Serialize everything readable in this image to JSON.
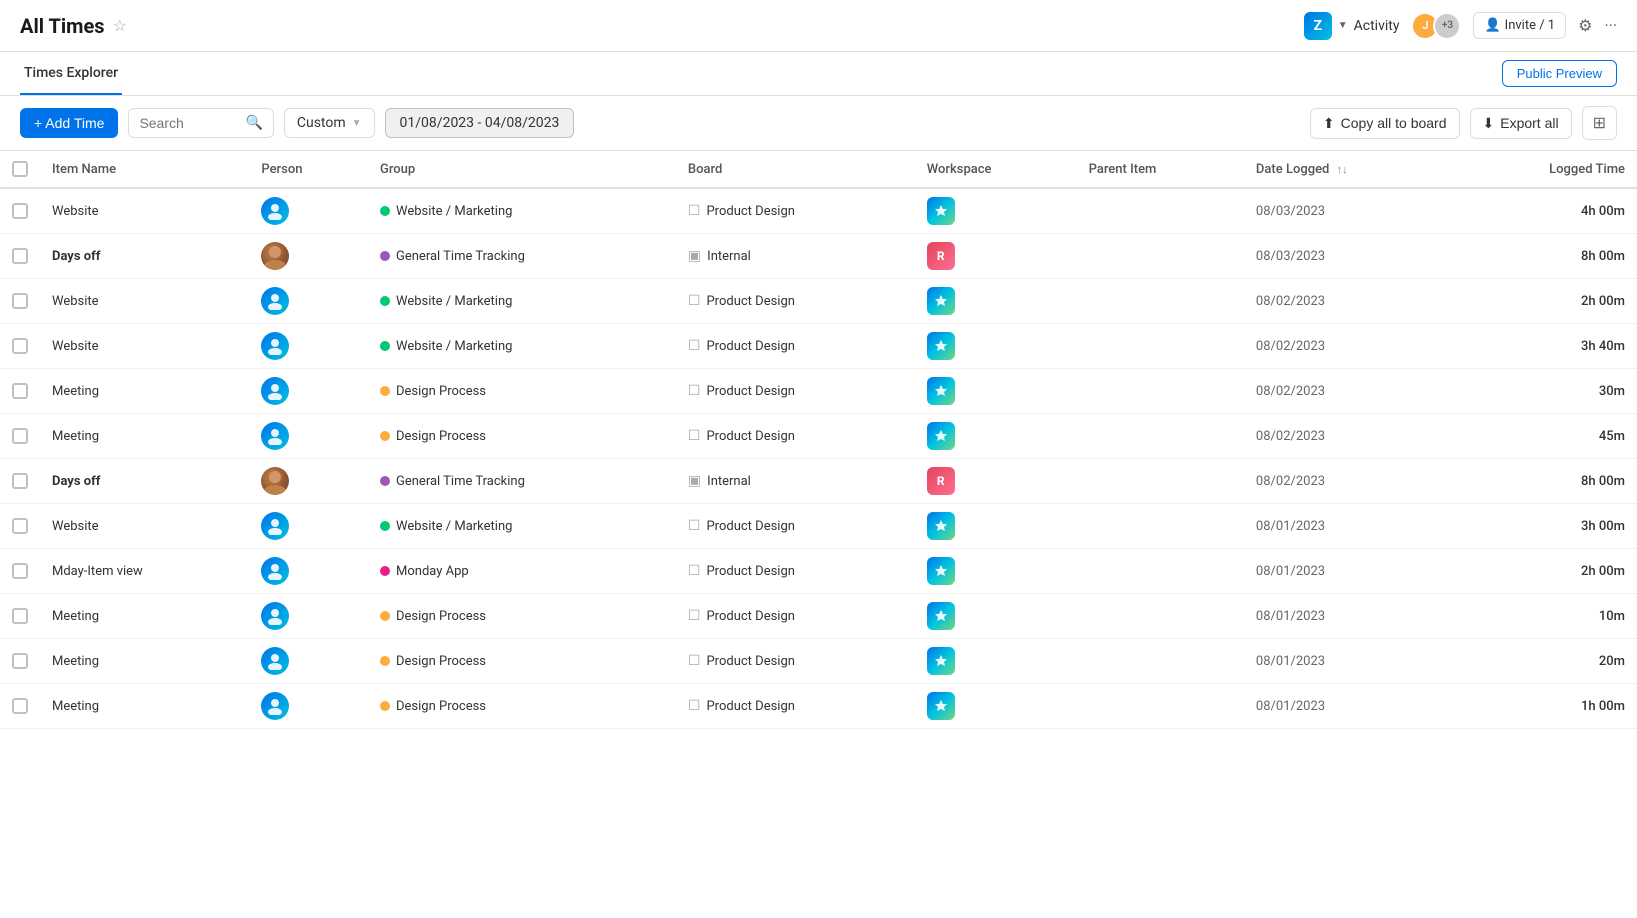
{
  "header": {
    "title": "All Times",
    "activity_label": "Activity",
    "app_icon": "Z",
    "invite_label": "Invite / 1",
    "avatar_count": "+3"
  },
  "sub_header": {
    "tab_label": "Times Explorer",
    "public_preview_label": "Public Preview"
  },
  "toolbar": {
    "add_time_label": "+ Add Time",
    "search_placeholder": "Search",
    "custom_label": "Custom",
    "date_range": "01/08/2023 - 04/08/2023",
    "copy_board_label": "Copy all to board",
    "export_label": "Export all"
  },
  "table": {
    "columns": [
      "Item Name",
      "Person",
      "Group",
      "Board",
      "Workspace",
      "Parent Item",
      "Date Logged",
      "Logged Time"
    ],
    "rows": [
      {
        "item": "Website",
        "person": "blue",
        "group": "Website / Marketing",
        "group_dot": "green",
        "board": "Product Design",
        "date": "08/03/2023",
        "time": "4h 00m",
        "bold": false,
        "group_type": "general"
      },
      {
        "item": "Days off",
        "person": "photo",
        "group": "General Time Tracking",
        "group_dot": "purple",
        "board": "Internal",
        "date": "08/03/2023",
        "time": "8h 00m",
        "bold": true,
        "group_type": "internal"
      },
      {
        "item": "Website",
        "person": "blue",
        "group": "Website / Marketing",
        "group_dot": "green",
        "board": "Product Design",
        "date": "08/02/2023",
        "time": "2h 00m",
        "bold": false,
        "group_type": "general"
      },
      {
        "item": "Website",
        "person": "blue",
        "group": "Website / Marketing",
        "group_dot": "green",
        "board": "Product Design",
        "date": "08/02/2023",
        "time": "3h 40m",
        "bold": false,
        "group_type": "general"
      },
      {
        "item": "Meeting",
        "person": "blue",
        "group": "Design Process",
        "group_dot": "orange",
        "board": "Product Design",
        "date": "08/02/2023",
        "time": "30m",
        "bold": false,
        "group_type": "general"
      },
      {
        "item": "Meeting",
        "person": "blue",
        "group": "Design Process",
        "group_dot": "orange",
        "board": "Product Design",
        "date": "08/02/2023",
        "time": "45m",
        "bold": false,
        "group_type": "general"
      },
      {
        "item": "Days off",
        "person": "photo",
        "group": "General Time Tracking",
        "group_dot": "purple",
        "board": "Internal",
        "date": "08/02/2023",
        "time": "8h 00m",
        "bold": true,
        "group_type": "internal"
      },
      {
        "item": "Website",
        "person": "blue",
        "group": "Website / Marketing",
        "group_dot": "green",
        "board": "Product Design",
        "date": "08/01/2023",
        "time": "3h 00m",
        "bold": false,
        "group_type": "general"
      },
      {
        "item": "Mday-Item view",
        "person": "blue",
        "group": "Monday App",
        "group_dot": "pink",
        "board": "Product Design",
        "date": "08/01/2023",
        "time": "2h 00m",
        "bold": false,
        "group_type": "general"
      },
      {
        "item": "Meeting",
        "person": "blue",
        "group": "Design Process",
        "group_dot": "orange",
        "board": "Product Design",
        "date": "08/01/2023",
        "time": "10m",
        "bold": false,
        "group_type": "general"
      },
      {
        "item": "Meeting",
        "person": "blue",
        "group": "Design Process",
        "group_dot": "orange",
        "board": "Product Design",
        "date": "08/01/2023",
        "time": "20m",
        "bold": false,
        "group_type": "general"
      },
      {
        "item": "Meeting",
        "person": "blue",
        "group": "Design Process",
        "group_dot": "orange",
        "board": "Product Design",
        "date": "08/01/2023",
        "time": "1h 00m",
        "bold": false,
        "group_type": "general"
      }
    ]
  }
}
